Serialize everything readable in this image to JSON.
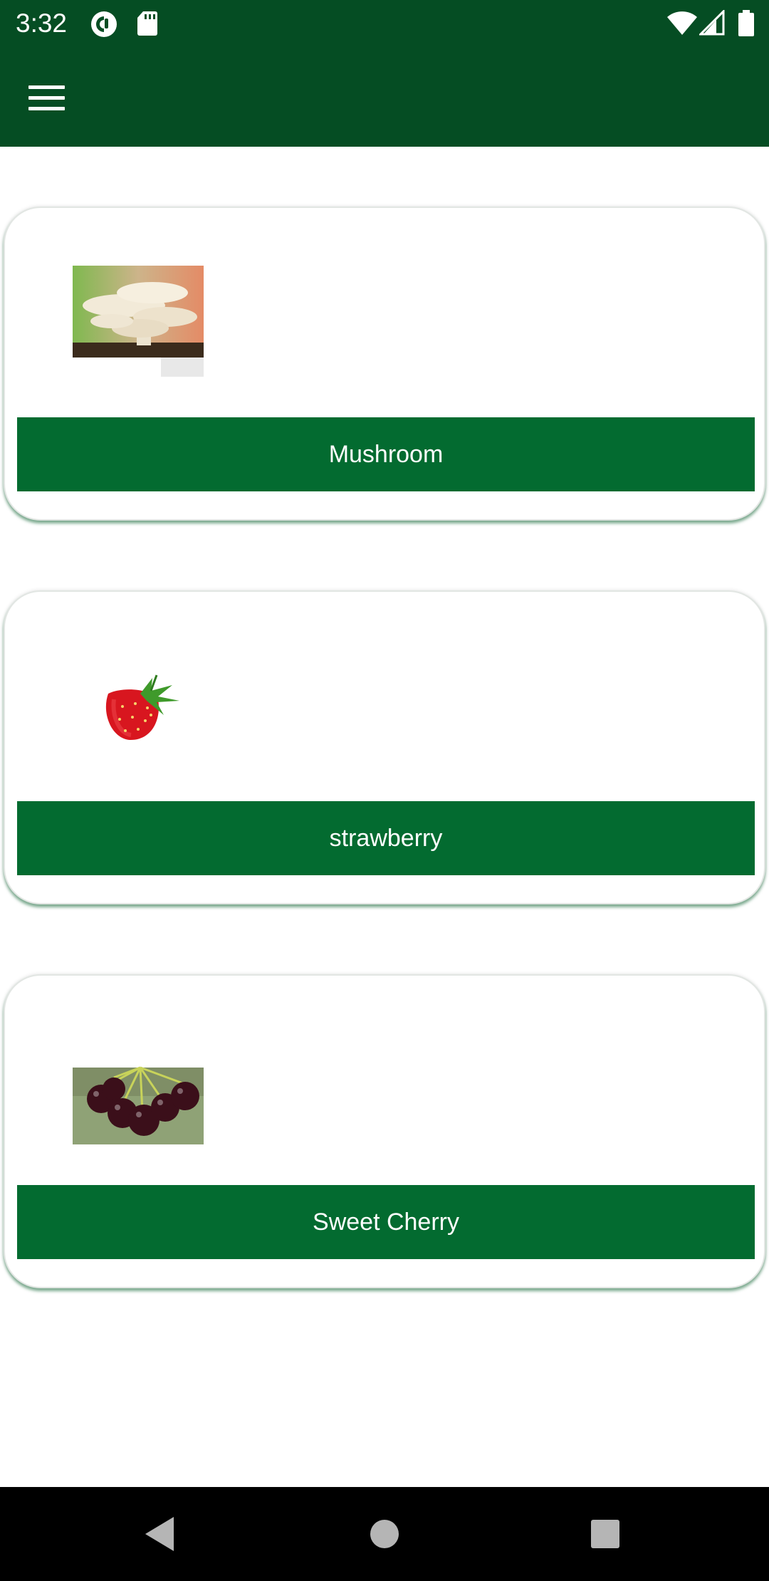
{
  "status_bar": {
    "time": "3:32",
    "left_icons": [
      "pocket-casts-icon",
      "sd-card-icon"
    ],
    "right_icons": [
      "wifi-icon",
      "cell-signal-icon",
      "battery-icon"
    ]
  },
  "toolbar": {
    "menu_icon": "hamburger-menu-icon",
    "background_color": "#054d23"
  },
  "items": [
    {
      "label": "Mushroom",
      "image": "mushroom-image"
    },
    {
      "label": "strawberry",
      "image": "strawberry-image"
    },
    {
      "label": "Sweet Cherry",
      "image": "sweet-cherry-image"
    }
  ],
  "colors": {
    "button": "#036b30",
    "header": "#054d23"
  },
  "nav_bar": {
    "buttons": [
      "back-icon",
      "home-icon",
      "recents-icon"
    ]
  }
}
